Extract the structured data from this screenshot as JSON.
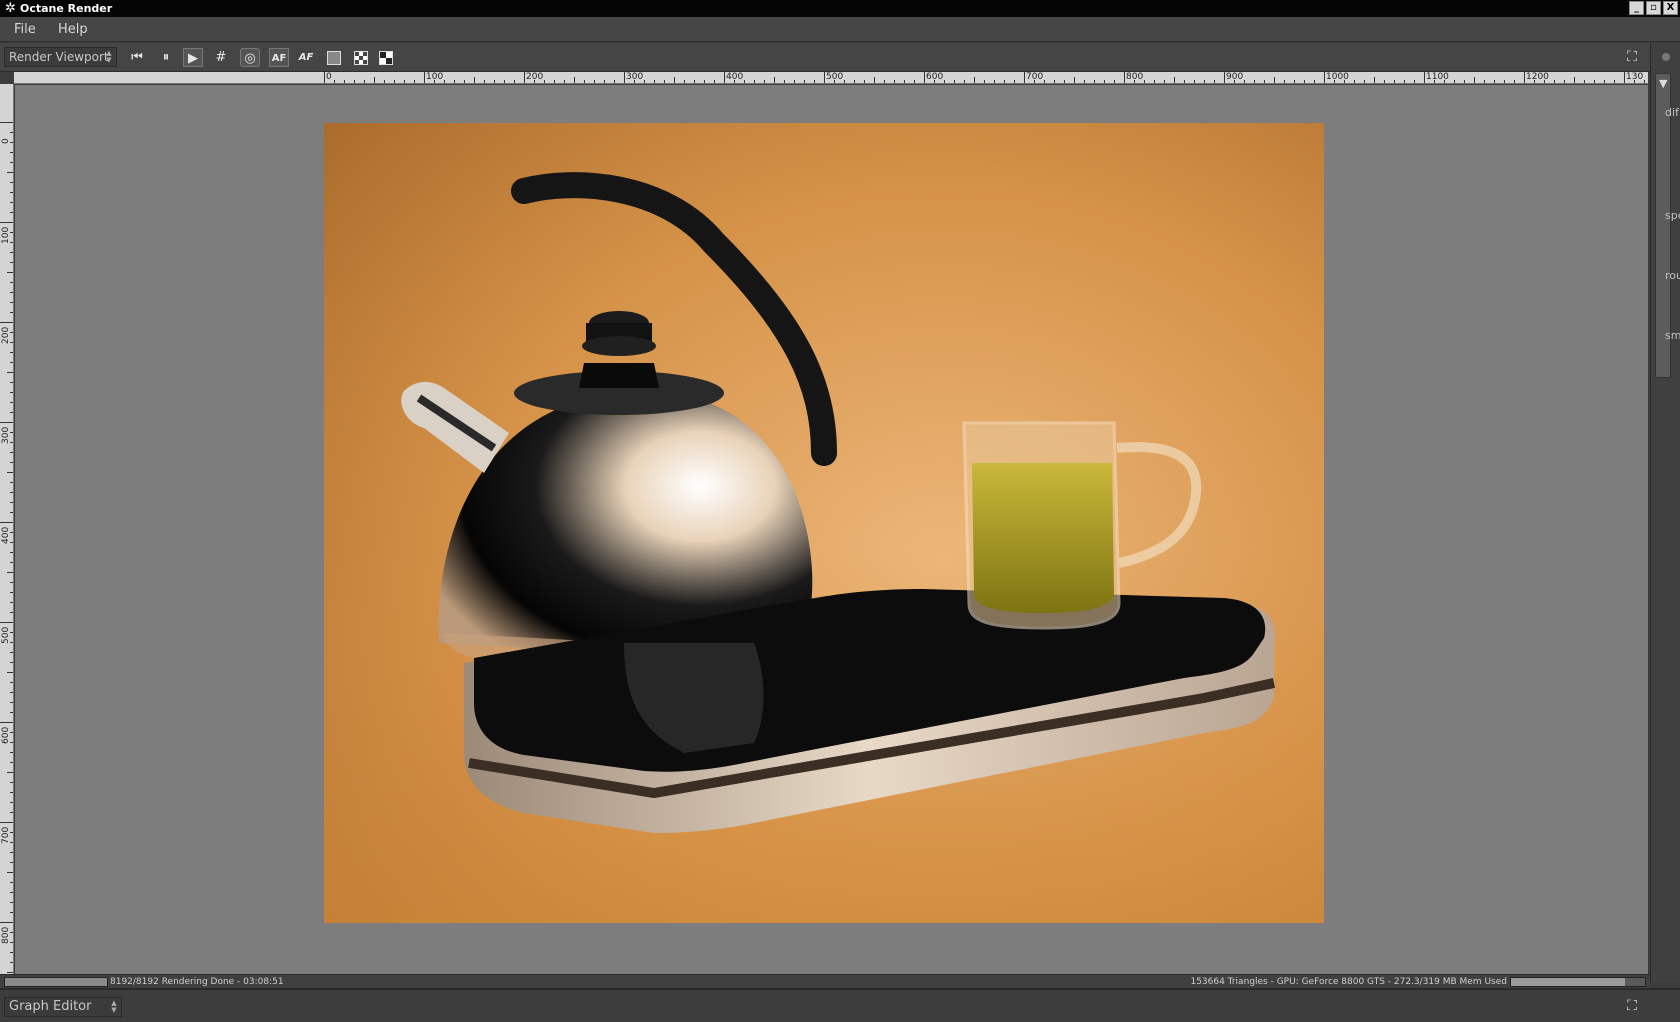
{
  "window": {
    "title": "Octane Render",
    "controls": {
      "minimize": "_",
      "restore": "▫",
      "close": "X"
    }
  },
  "menu": {
    "file": "File",
    "help": "Help"
  },
  "toolbar": {
    "view_selector": "Render Viewport",
    "buttons": {
      "restart": "⏮",
      "pause": "⏸",
      "start": "▶",
      "region": "#",
      "focus_picker": "◎",
      "autofocus": "AF",
      "autofocus_alt": "AF"
    }
  },
  "ruler": {
    "horizontal_labels": [
      "0",
      "100",
      "200",
      "300",
      "400",
      "500",
      "600",
      "700",
      "800",
      "900",
      "1000",
      "1100",
      "1200",
      "130"
    ],
    "vertical_labels": [
      "0",
      "100",
      "200",
      "300",
      "400",
      "500",
      "600",
      "700",
      "800"
    ]
  },
  "side_panel": {
    "labels": [
      "dif",
      "spe",
      "rou",
      "sm"
    ]
  },
  "status": {
    "progress": 1.0,
    "samples_text": "8192/8192 Rendering Done - 03:08:51",
    "stats_text": "153664 Triangles - GPU: GeForce 8800 GTS - 272.3/319 MB Mem Used",
    "memory_used_fraction": 0.854
  },
  "graph_editor": {
    "label": "Graph Editor"
  },
  "colors": {
    "viewport_bg": "#7d7d7d",
    "render_bg_light": "#e6a866",
    "render_bg_dark": "#b5722a"
  }
}
